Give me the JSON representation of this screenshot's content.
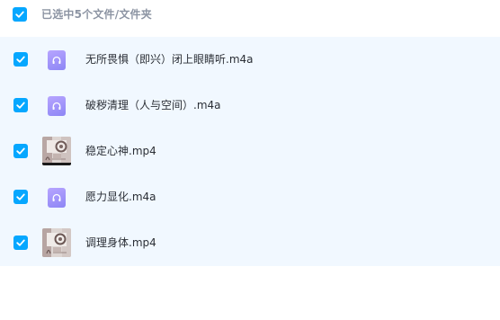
{
  "header": {
    "selection_label": "已选中5个文件/文件夹"
  },
  "files": [
    {
      "name": "无所畏惧（即兴）闭上眼睛听.m4a",
      "type": "audio",
      "icon": "audio-file-icon"
    },
    {
      "name": "破秽清理（人与空间）.m4a",
      "type": "audio",
      "icon": "audio-file-icon"
    },
    {
      "name": "稳定心神.mp4",
      "type": "video",
      "icon": "video-thumbnail"
    },
    {
      "name": "愿力显化.m4a",
      "type": "audio",
      "icon": "audio-file-icon"
    },
    {
      "name": "调理身体.mp4",
      "type": "video",
      "icon": "video-thumbnail"
    }
  ],
  "colors": {
    "checkbox": "#06a7ff",
    "list_background": "#f1f8ff",
    "header_text": "#8c94a3",
    "file_text": "#2b2f36",
    "audio_icon": "#9c93f8"
  }
}
